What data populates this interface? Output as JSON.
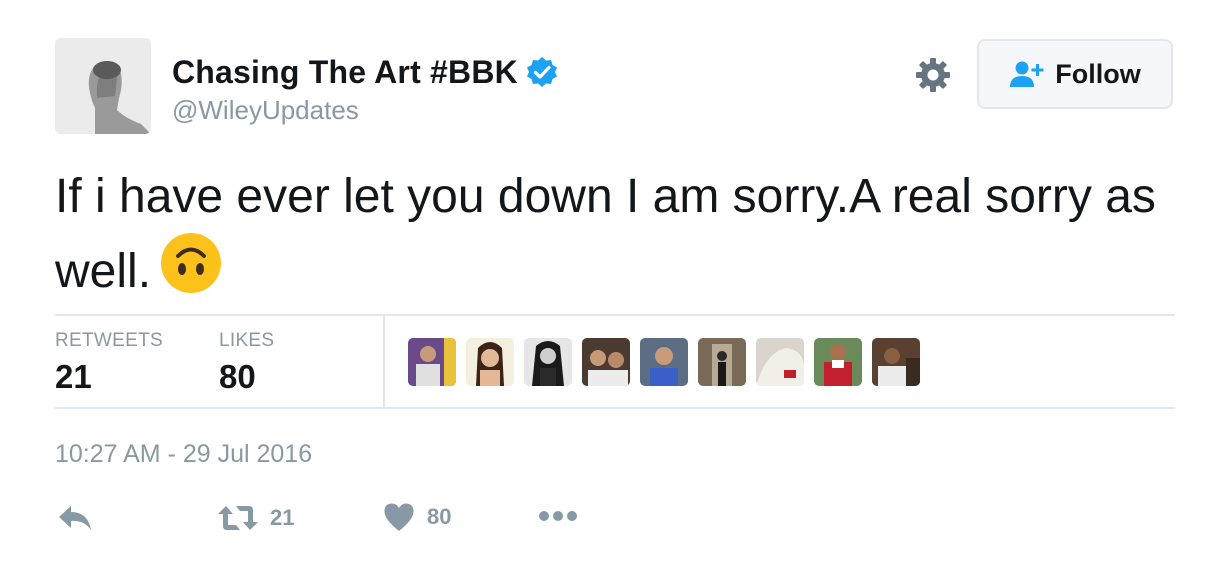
{
  "author": {
    "name": "Chasing The Art #BBK",
    "handle": "@WileyUpdates",
    "verified": true
  },
  "follow_button": {
    "label": "Follow"
  },
  "tweet": {
    "text": "If i have ever let you down I am sorry.A real sorry as well.",
    "emoji": "upside-down-face"
  },
  "stats": {
    "retweets_label": "RETWEETS",
    "retweets_count": "21",
    "likes_label": "LIKES",
    "likes_count": "80"
  },
  "liker_avatar_count": 9,
  "timestamp": "10:27 AM - 29 Jul 2016",
  "actions": {
    "retweet_count": "21",
    "like_count": "80"
  },
  "colors": {
    "accent": "#1da1f2",
    "muted": "#8899a6",
    "text": "#14171a",
    "divider": "#e1e8ed"
  },
  "icons": [
    "verified-badge-icon",
    "gear-icon",
    "follow-user-icon",
    "reply-icon",
    "retweet-icon",
    "heart-icon",
    "more-icon"
  ]
}
